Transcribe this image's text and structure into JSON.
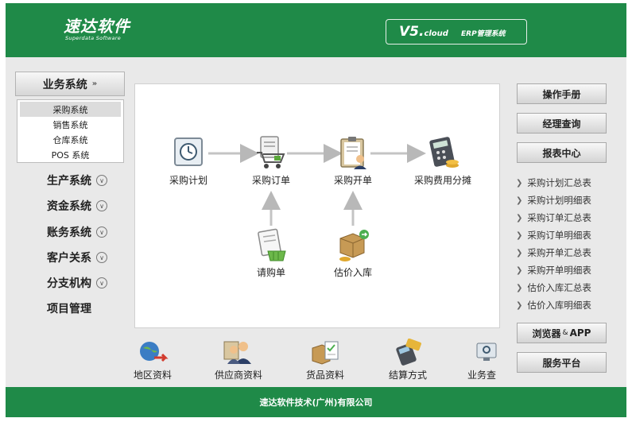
{
  "header": {
    "logo_cn": "速达软件",
    "logo_en": "Superdata Software",
    "version": "V5.",
    "version_suffix": "cloud",
    "erp_label": "ERP管理系统"
  },
  "left": {
    "active_menu": "业务系统",
    "submenu": [
      "采购系统",
      "销售系统",
      "仓库系统",
      "POS 系统"
    ],
    "menus": [
      "生产系统",
      "资金系统",
      "账务系统",
      "客户关系",
      "分支机构",
      "项目管理"
    ]
  },
  "flow": {
    "nodes": {
      "plan": "采购计划",
      "order": "采购订单",
      "bill": "采购开单",
      "cost": "采购费用分摊",
      "request": "请购单",
      "estimate": "估价入库"
    }
  },
  "bottom": [
    "地区资料",
    "供应商资料",
    "货品资料",
    "结算方式",
    "业务查"
  ],
  "right": {
    "manual": "操作手册",
    "manager_query": "经理查询",
    "report_center": "报表中心",
    "reports": [
      "采购计划汇总表",
      "采购计划明细表",
      "采购订单汇总表",
      "采购订单明细表",
      "采购开单汇总表",
      "采购开单明细表",
      "估价入库汇总表",
      "估价入库明细表"
    ],
    "browser": "浏览器",
    "browser_amp": "&",
    "app": "APP",
    "service": "服务平台"
  },
  "footer": {
    "company": "速达软件技术(广州)有限公司"
  },
  "colors": {
    "brand_green": "#1f8a48",
    "panel_gray": "#e9e9e9"
  }
}
